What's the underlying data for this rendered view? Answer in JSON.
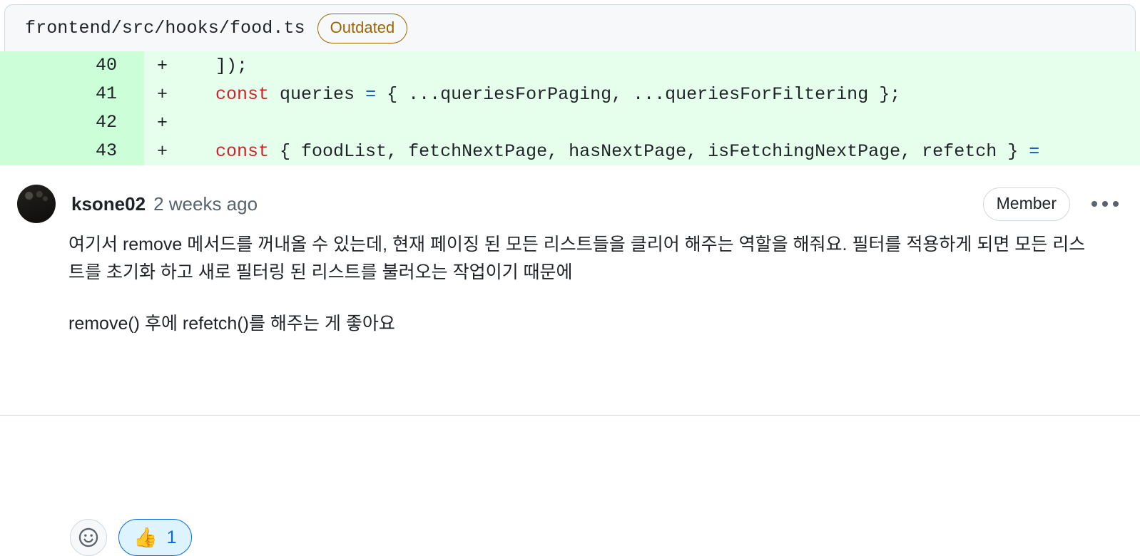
{
  "file_header": {
    "path": "frontend/src/hooks/food.ts",
    "badge": "Outdated",
    "badge_color": "#9a6700"
  },
  "diff": {
    "background": "#e6ffec",
    "gutter_background": "#ccffd8",
    "rows": [
      {
        "lineno": "40",
        "marker": "+",
        "segments": [
          {
            "text": "  ]);",
            "kind": "plain"
          }
        ]
      },
      {
        "lineno": "41",
        "marker": "+",
        "segments": [
          {
            "text": "  ",
            "kind": "plain"
          },
          {
            "text": "const",
            "kind": "keyword"
          },
          {
            "text": " queries ",
            "kind": "plain"
          },
          {
            "text": "=",
            "kind": "operator"
          },
          {
            "text": " { ...queriesForPaging, ...queriesForFiltering };",
            "kind": "plain"
          }
        ]
      },
      {
        "lineno": "42",
        "marker": "+",
        "segments": [
          {
            "text": "",
            "kind": "plain"
          }
        ]
      },
      {
        "lineno": "43",
        "marker": "+",
        "segments": [
          {
            "text": "  ",
            "kind": "plain"
          },
          {
            "text": "const",
            "kind": "keyword"
          },
          {
            "text": " { foodList, fetchNextPage, hasNextPage, isFetchingNextPage, refetch } ",
            "kind": "plain"
          },
          {
            "text": "=",
            "kind": "operator"
          }
        ]
      }
    ]
  },
  "comment": {
    "author": "ksone02",
    "timestamp": "2 weeks ago",
    "role_badge": "Member",
    "menu_icon": "kebab-horizontal-icon",
    "avatar_icon": "user-avatar",
    "paragraphs": [
      "여기서 remove 메서드를 꺼내올 수 있는데, 현재 페이징 된 모든 리스트들을 클리어 해주는 역할을 해줘요. 필터를 적용하게 되면 모든 리스트를 초기화 하고 새로 필터링 된 리스트를 불러오는 작업이기 때문에",
      "remove() 후에 refetch()를 해주는 게 좋아요"
    ]
  },
  "reactions": {
    "add_reaction_icon": "smiley-icon",
    "items": [
      {
        "emoji": "👍",
        "emoji_name": "thumbs-up-emoji",
        "count": "1",
        "active": true,
        "accent_color": "#0969da",
        "background": "#ddf4ff"
      }
    ]
  }
}
